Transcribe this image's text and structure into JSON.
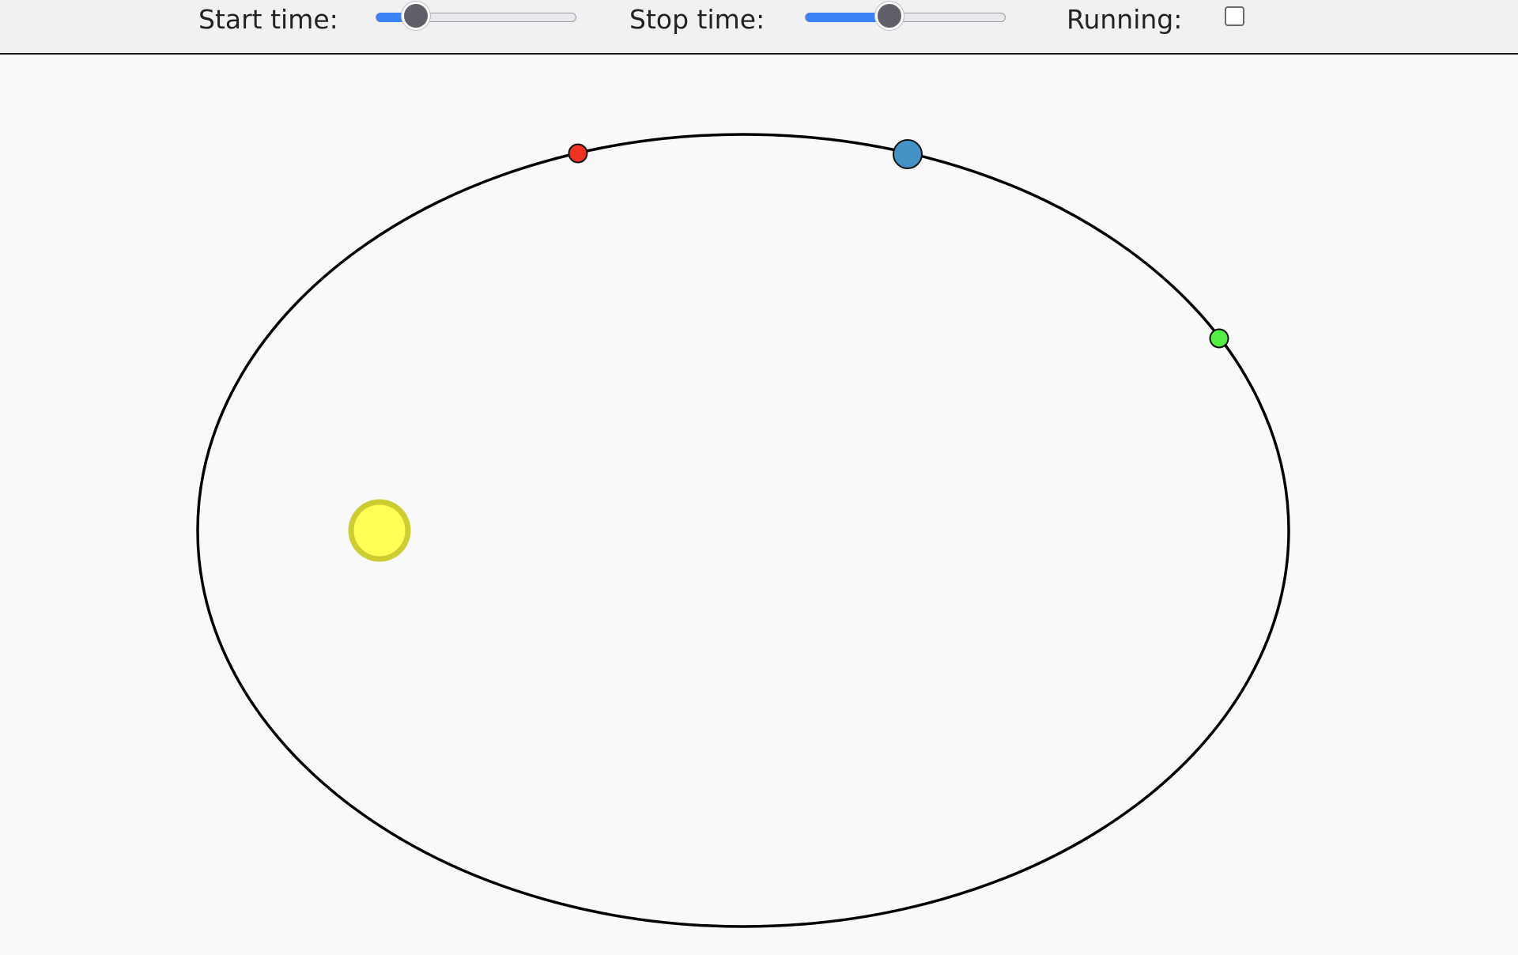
{
  "controls": {
    "start_time": {
      "label": "Start time:",
      "value": 0.2,
      "accent_color": "#3b82f6"
    },
    "stop_time": {
      "label": "Stop time:",
      "value": 0.42,
      "accent_color": "#3b82f6"
    },
    "running": {
      "label": "Running:",
      "checked": false
    }
  },
  "scene": {
    "orbit": {
      "stroke_color": "#000000",
      "fill_color": "none"
    },
    "sun": {
      "fill_color": "#ffff55",
      "stroke_color": "#cccc33"
    },
    "planet": {
      "fill_color": "#4592c6",
      "stroke_color": "#111111"
    },
    "start_marker": {
      "fill_color": "#ee3322",
      "stroke_color": "#111111"
    },
    "stop_marker": {
      "fill_color": "#55ee44",
      "stroke_color": "#111111"
    }
  }
}
